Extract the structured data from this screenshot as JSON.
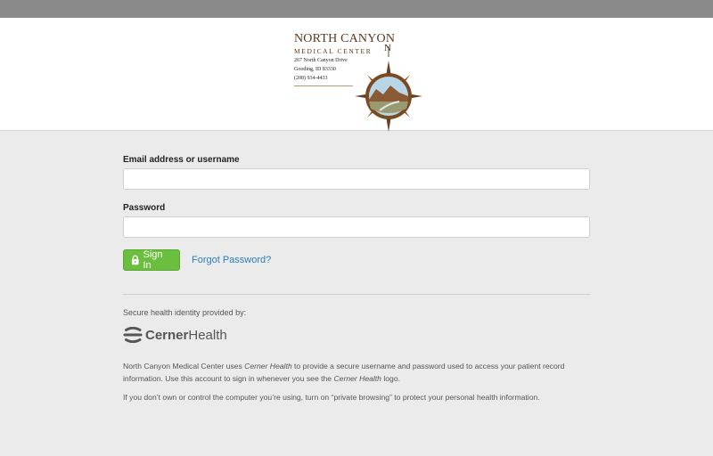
{
  "logo": {
    "title": "NORTH CANYON",
    "subtitle": "MEDICAL CENTER",
    "address_line1": "267 North Canyon Drive",
    "address_line2": "Gooding, ID  83330",
    "phone": "(208) 934-4433",
    "compass_letter": "N"
  },
  "login": {
    "username_label": "Email address or username",
    "username_value": "",
    "password_label": "Password",
    "password_value": "",
    "signin_label": "Sign In",
    "forgot_label": "Forgot Password?"
  },
  "identity": {
    "provided_by": "Secure health identity provided by:",
    "brand_bold": "Cerner",
    "brand_light": "Health",
    "para1_a": "North Canyon Medical Center uses ",
    "para1_em1": "Cerner Health",
    "para1_b": " to provide a secure username and password used to access your patient record information. Use this account to sign in whenever you see the ",
    "para1_em2": "Cerner Health",
    "para1_c": " logo.",
    "para2": "If you don’t own or control the computer you’re using, turn on “private browsing” to protect your personal health information."
  },
  "colors": {
    "topbar": "#8a8a8a",
    "signin_button": "#6bbf3f",
    "link": "#2a7fb8",
    "background": "#ebebeb"
  },
  "icons": {
    "signin": "lock-icon",
    "brand": "cerner-logo-icon",
    "compass": "compass-icon"
  }
}
